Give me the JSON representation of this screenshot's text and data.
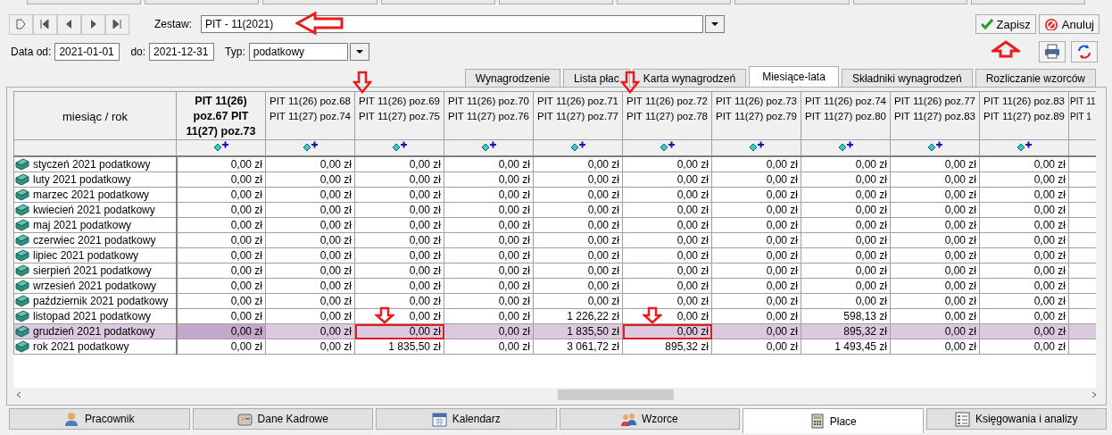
{
  "navigator": {
    "buttons": [
      {
        "kind": "new"
      },
      {
        "kind": "first"
      },
      {
        "kind": "prev"
      },
      {
        "kind": "next"
      },
      {
        "kind": "last"
      }
    ]
  },
  "zestaw": {
    "label": "Zestaw:",
    "value": "PIT - 11(2021)",
    "marked": true
  },
  "actions": [
    {
      "kind": "save",
      "label": "Zapisz",
      "marked": true
    },
    {
      "kind": "cancel",
      "label": "Anuluj"
    }
  ],
  "tools": [
    {
      "kind": "print"
    },
    {
      "kind": "refresh"
    }
  ],
  "filters": {
    "date_from_label": "Data od:",
    "date_from": "2021-01-01",
    "date_to_label": "do:",
    "date_to": "2021-12-31",
    "type_label": "Typ:",
    "type": "podatkowy"
  },
  "tabs": [
    {
      "label": "Wynagrodzenie",
      "selected": false
    },
    {
      "label": "Lista płac",
      "selected": false
    },
    {
      "label": "Karta wynagrodzeń",
      "selected": false
    },
    {
      "label": "Miesiące-lata",
      "selected": true
    },
    {
      "label": "Składniki wynagrodzeń",
      "selected": false
    },
    {
      "label": "Rozliczanie wzorców",
      "selected": false
    }
  ],
  "grid": {
    "corner": "miesiąc / rok",
    "columns": [
      {
        "kind": "full",
        "header": "PIT 11(26) poz.67 PIT 11(27) poz.73",
        "bold": true,
        "marked": false
      },
      {
        "kind": "full",
        "header": "PIT 11(26) poz.68 PIT 11(27) poz.74",
        "bold": false,
        "marked": false
      },
      {
        "kind": "full",
        "header": "PIT 11(26) poz.69 PIT 11(27) poz.75",
        "bold": false,
        "marked": true
      },
      {
        "kind": "full",
        "header": "PIT 11(26) poz.70 PIT 11(27) poz.76",
        "bold": false,
        "marked": false
      },
      {
        "kind": "full",
        "header": "PIT 11(26) poz.71 PIT 11(27) poz.77",
        "bold": false,
        "marked": false
      },
      {
        "kind": "full",
        "header": "PIT 11(26) poz.72 PIT 11(27) poz.78",
        "bold": false,
        "marked": true
      },
      {
        "kind": "full",
        "header": "PIT 11(26) poz.73 PIT 11(27) poz.79",
        "bold": false,
        "marked": false
      },
      {
        "kind": "full",
        "header": "PIT 11(26) poz.74 PIT 11(27) poz.80",
        "bold": false,
        "marked": false
      },
      {
        "kind": "full",
        "header": "PIT 11(26) poz.77 PIT 11(27) poz.83",
        "bold": false,
        "marked": false
      },
      {
        "kind": "full",
        "header": "PIT 11(26) poz.83 PIT 11(27) poz.89",
        "bold": false,
        "marked": false
      },
      {
        "kind": "partial",
        "header": "PIT 11 PIT 1",
        "bold": false,
        "marked": false
      }
    ],
    "rows": [
      {
        "label": "styczeń 2021 podatkowy",
        "selected": false,
        "cells": [
          {
            "text": "0,00 zł",
            "marked": false
          },
          {
            "text": "0,00 zł",
            "marked": false
          },
          {
            "text": "0,00 zł",
            "marked": false
          },
          {
            "text": "0,00 zł",
            "marked": false
          },
          {
            "text": "0,00 zł",
            "marked": false
          },
          {
            "text": "0,00 zł",
            "marked": false
          },
          {
            "text": "0,00 zł",
            "marked": false
          },
          {
            "text": "0,00 zł",
            "marked": false
          },
          {
            "text": "0,00 zł",
            "marked": false
          },
          {
            "text": "0,00 zł",
            "marked": false
          }
        ]
      },
      {
        "label": "luty 2021 podatkowy",
        "selected": false,
        "cells": [
          {
            "text": "0,00 zł",
            "marked": false
          },
          {
            "text": "0,00 zł",
            "marked": false
          },
          {
            "text": "0,00 zł",
            "marked": false
          },
          {
            "text": "0,00 zł",
            "marked": false
          },
          {
            "text": "0,00 zł",
            "marked": false
          },
          {
            "text": "0,00 zł",
            "marked": false
          },
          {
            "text": "0,00 zł",
            "marked": false
          },
          {
            "text": "0,00 zł",
            "marked": false
          },
          {
            "text": "0,00 zł",
            "marked": false
          },
          {
            "text": "0,00 zł",
            "marked": false
          }
        ]
      },
      {
        "label": "marzec 2021 podatkowy",
        "selected": false,
        "cells": [
          {
            "text": "0,00 zł",
            "marked": false
          },
          {
            "text": "0,00 zł",
            "marked": false
          },
          {
            "text": "0,00 zł",
            "marked": false
          },
          {
            "text": "0,00 zł",
            "marked": false
          },
          {
            "text": "0,00 zł",
            "marked": false
          },
          {
            "text": "0,00 zł",
            "marked": false
          },
          {
            "text": "0,00 zł",
            "marked": false
          },
          {
            "text": "0,00 zł",
            "marked": false
          },
          {
            "text": "0,00 zł",
            "marked": false
          },
          {
            "text": "0,00 zł",
            "marked": false
          }
        ]
      },
      {
        "label": "kwiecień 2021 podatkowy",
        "selected": false,
        "cells": [
          {
            "text": "0,00 zł",
            "marked": false
          },
          {
            "text": "0,00 zł",
            "marked": false
          },
          {
            "text": "0,00 zł",
            "marked": false
          },
          {
            "text": "0,00 zł",
            "marked": false
          },
          {
            "text": "0,00 zł",
            "marked": false
          },
          {
            "text": "0,00 zł",
            "marked": false
          },
          {
            "text": "0,00 zł",
            "marked": false
          },
          {
            "text": "0,00 zł",
            "marked": false
          },
          {
            "text": "0,00 zł",
            "marked": false
          },
          {
            "text": "0,00 zł",
            "marked": false
          }
        ]
      },
      {
        "label": "maj 2021 podatkowy",
        "selected": false,
        "cells": [
          {
            "text": "0,00 zł",
            "marked": false
          },
          {
            "text": "0,00 zł",
            "marked": false
          },
          {
            "text": "0,00 zł",
            "marked": false
          },
          {
            "text": "0,00 zł",
            "marked": false
          },
          {
            "text": "0,00 zł",
            "marked": false
          },
          {
            "text": "0,00 zł",
            "marked": false
          },
          {
            "text": "0,00 zł",
            "marked": false
          },
          {
            "text": "0,00 zł",
            "marked": false
          },
          {
            "text": "0,00 zł",
            "marked": false
          },
          {
            "text": "0,00 zł",
            "marked": false
          }
        ]
      },
      {
        "label": "czerwiec 2021 podatkowy",
        "selected": false,
        "cells": [
          {
            "text": "0,00 zł",
            "marked": false
          },
          {
            "text": "0,00 zł",
            "marked": false
          },
          {
            "text": "0,00 zł",
            "marked": false
          },
          {
            "text": "0,00 zł",
            "marked": false
          },
          {
            "text": "0,00 zł",
            "marked": false
          },
          {
            "text": "0,00 zł",
            "marked": false
          },
          {
            "text": "0,00 zł",
            "marked": false
          },
          {
            "text": "0,00 zł",
            "marked": false
          },
          {
            "text": "0,00 zł",
            "marked": false
          },
          {
            "text": "0,00 zł",
            "marked": false
          }
        ]
      },
      {
        "label": "lipiec 2021 podatkowy",
        "selected": false,
        "cells": [
          {
            "text": "0,00 zł",
            "marked": false
          },
          {
            "text": "0,00 zł",
            "marked": false
          },
          {
            "text": "0,00 zł",
            "marked": false
          },
          {
            "text": "0,00 zł",
            "marked": false
          },
          {
            "text": "0,00 zł",
            "marked": false
          },
          {
            "text": "0,00 zł",
            "marked": false
          },
          {
            "text": "0,00 zł",
            "marked": false
          },
          {
            "text": "0,00 zł",
            "marked": false
          },
          {
            "text": "0,00 zł",
            "marked": false
          },
          {
            "text": "0,00 zł",
            "marked": false
          }
        ]
      },
      {
        "label": "sierpień 2021 podatkowy",
        "selected": false,
        "cells": [
          {
            "text": "0,00 zł",
            "marked": false
          },
          {
            "text": "0,00 zł",
            "marked": false
          },
          {
            "text": "0,00 zł",
            "marked": false
          },
          {
            "text": "0,00 zł",
            "marked": false
          },
          {
            "text": "0,00 zł",
            "marked": false
          },
          {
            "text": "0,00 zł",
            "marked": false
          },
          {
            "text": "0,00 zł",
            "marked": false
          },
          {
            "text": "0,00 zł",
            "marked": false
          },
          {
            "text": "0,00 zł",
            "marked": false
          },
          {
            "text": "0,00 zł",
            "marked": false
          }
        ]
      },
      {
        "label": "wrzesień 2021 podatkowy",
        "selected": false,
        "cells": [
          {
            "text": "0,00 zł",
            "marked": false
          },
          {
            "text": "0,00 zł",
            "marked": false
          },
          {
            "text": "0,00 zł",
            "marked": false
          },
          {
            "text": "0,00 zł",
            "marked": false
          },
          {
            "text": "0,00 zł",
            "marked": false
          },
          {
            "text": "0,00 zł",
            "marked": false
          },
          {
            "text": "0,00 zł",
            "marked": false
          },
          {
            "text": "0,00 zł",
            "marked": false
          },
          {
            "text": "0,00 zł",
            "marked": false
          },
          {
            "text": "0,00 zł",
            "marked": false
          }
        ]
      },
      {
        "label": "październik 2021 podatkowy",
        "selected": false,
        "cells": [
          {
            "text": "0,00 zł",
            "marked": false
          },
          {
            "text": "0,00 zł",
            "marked": false
          },
          {
            "text": "0,00 zł",
            "marked": false
          },
          {
            "text": "0,00 zł",
            "marked": false
          },
          {
            "text": "0,00 zł",
            "marked": false
          },
          {
            "text": "0,00 zł",
            "marked": false
          },
          {
            "text": "0,00 zł",
            "marked": false
          },
          {
            "text": "0,00 zł",
            "marked": false
          },
          {
            "text": "0,00 zł",
            "marked": false
          },
          {
            "text": "0,00 zł",
            "marked": false
          }
        ]
      },
      {
        "label": "listopad 2021 podatkowy",
        "selected": false,
        "cells": [
          {
            "text": "0,00 zł",
            "marked": false
          },
          {
            "text": "0,00 zł",
            "marked": false
          },
          {
            "text": "0,00 zł",
            "marked": false
          },
          {
            "text": "0,00 zł",
            "marked": false
          },
          {
            "text": "1 226,22 zł",
            "marked": false
          },
          {
            "text": "0,00 zł",
            "marked": false
          },
          {
            "text": "0,00 zł",
            "marked": false
          },
          {
            "text": "598,13 zł",
            "marked": false
          },
          {
            "text": "0,00 zł",
            "marked": false
          },
          {
            "text": "0,00 zł",
            "marked": false
          }
        ]
      },
      {
        "label": "grudzień 2021 podatkowy",
        "selected": true,
        "cells": [
          {
            "text": "0,00 zł",
            "marked": false
          },
          {
            "text": "0,00 zł",
            "marked": false
          },
          {
            "text": "0,00 zł",
            "marked": true
          },
          {
            "text": "0,00 zł",
            "marked": false
          },
          {
            "text": "1 835,50 zł",
            "marked": false
          },
          {
            "text": "0,00 zł",
            "marked": true
          },
          {
            "text": "0,00 zł",
            "marked": false
          },
          {
            "text": "895,32 zł",
            "marked": false
          },
          {
            "text": "0,00 zł",
            "marked": false
          },
          {
            "text": "0,00 zł",
            "marked": false
          }
        ]
      },
      {
        "label": "rok 2021 podatkowy",
        "selected": false,
        "cells": [
          {
            "text": "0,00 zł",
            "marked": false
          },
          {
            "text": "0,00 zł",
            "marked": false
          },
          {
            "text": "1 835,50 zł",
            "marked": false
          },
          {
            "text": "0,00 zł",
            "marked": false
          },
          {
            "text": "3 061,72 zł",
            "marked": false
          },
          {
            "text": "895,32 zł",
            "marked": false
          },
          {
            "text": "0,00 zł",
            "marked": false
          },
          {
            "text": "1 493,45 zł",
            "marked": false
          },
          {
            "text": "0,00 zł",
            "marked": false
          },
          {
            "text": "0,00 zł",
            "marked": false
          }
        ]
      }
    ]
  },
  "bottom_tabs": [
    {
      "label": "Pracownik",
      "kind": "person",
      "selected": false
    },
    {
      "label": "Dane Kadrowe",
      "kind": "card",
      "selected": false
    },
    {
      "label": "Kalendarz",
      "kind": "calendar",
      "selected": false
    },
    {
      "label": "Wzorce",
      "kind": "people",
      "selected": false
    },
    {
      "label": "Płace",
      "kind": "calculator",
      "selected": true
    },
    {
      "label": "Księgowania i analizy",
      "kind": "ledger",
      "selected": false
    }
  ]
}
